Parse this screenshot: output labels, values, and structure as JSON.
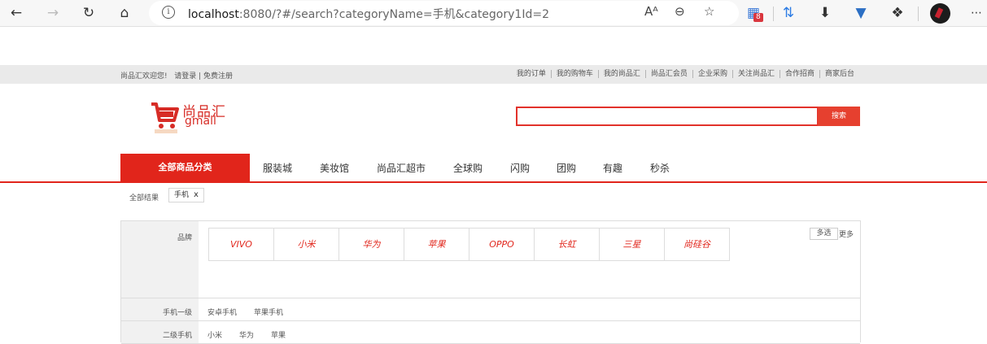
{
  "browser": {
    "url_host": "localhost",
    "url_rest": ":8080/?#/search?categoryName=手机&category1Id=2",
    "extension_badge": "8"
  },
  "topbar": {
    "welcome": "尚品汇欢迎您!",
    "login": "请登录",
    "divider": "|",
    "register": "免费注册",
    "links": [
      "我的订单",
      "我的购物车",
      "我的尚品汇",
      "尚品汇会员",
      "企业采购",
      "关注尚品汇",
      "合作招商",
      "商家后台"
    ]
  },
  "header": {
    "logo_cn": "尚品汇",
    "logo_en": "gmall",
    "search_value": "",
    "search_button": "搜索"
  },
  "nav": {
    "all_categories": "全部商品分类",
    "items": [
      "服装城",
      "美妆馆",
      "尚品汇超市",
      "全球购",
      "闪购",
      "团购",
      "有趣",
      "秒杀"
    ]
  },
  "breadcrumb": {
    "all": "全部结果",
    "tag": "手机",
    "remove": "x"
  },
  "selector": {
    "brand_label": "品牌",
    "brands": [
      "VIVO",
      "小米",
      "华为",
      "苹果",
      "OPPO",
      "长虹",
      "三星",
      "尚硅谷"
    ],
    "multi_select": "多选",
    "more": "更多",
    "rows": [
      {
        "label": "手机一级",
        "values": [
          "安卓手机",
          "苹果手机"
        ]
      },
      {
        "label": "二级手机",
        "values": [
          "小米",
          "华为",
          "苹果"
        ]
      }
    ]
  },
  "colors": {
    "accent": "#e1251b",
    "search_border": "#e2322b"
  }
}
